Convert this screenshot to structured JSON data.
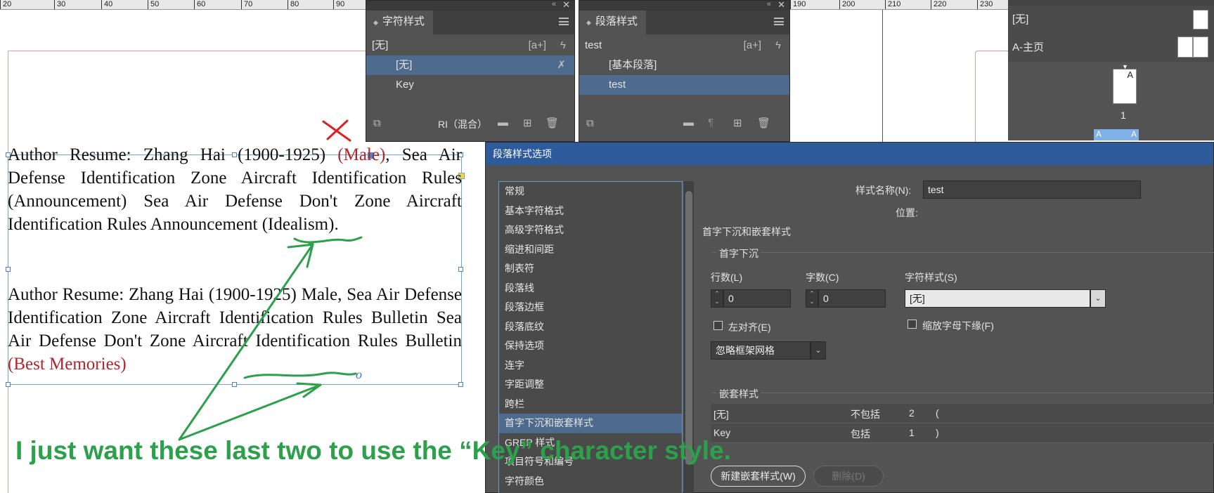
{
  "ruler": {
    "left_ticks": [
      "20",
      "30",
      "40",
      "50",
      "60",
      "70",
      "80",
      "90"
    ],
    "right_ticks": [
      "190",
      "200",
      "210",
      "220",
      "230"
    ]
  },
  "document": {
    "para1": {
      "text_a": "Author Resume: Zhang Hai (1900-1925) ",
      "text_red": "(Male)",
      "text_b": ", Sea Air Defense Identification Zone Aircraft Identification Rules (Announcement) Sea Air Defense Don't Zone Aircraft Identification Rules Announcement (Idealism)."
    },
    "para2": {
      "text_a": "Author Resume: Zhang Hai (1900-1925) Male, Sea Air Defense Identification Zone Aircraft Identification Rules Bulletin Sea Air Defense Don't Zone Aircraft Identification Rules Bulletin ",
      "text_red": "(Best Memories)"
    },
    "overset": "o"
  },
  "char_styles_panel": {
    "tab": "字符样式",
    "current": "[无]",
    "items": [
      "[无]",
      "Key"
    ],
    "footer_label": "RI（混合）"
  },
  "para_styles_panel": {
    "tab": "段落样式",
    "current": "test",
    "items": [
      "[基本段落]",
      "test"
    ]
  },
  "pages_panel": {
    "none_label": "[无]",
    "master_label": "A-主页",
    "page_letter": "A",
    "page_number": "1",
    "spread_left": "A",
    "spread_right": "A"
  },
  "dialog": {
    "title": "段落样式选项",
    "categories": [
      "常规",
      "基本字符格式",
      "高级字符格式",
      "缩进和间距",
      "制表符",
      "段落线",
      "段落边框",
      "段落底纹",
      "保持选项",
      "连字",
      "字距调整",
      "跨栏",
      "首字下沉和嵌套样式",
      "GREP 样式",
      "项目符号和编号",
      "字符颜色"
    ],
    "selected_category": "首字下沉和嵌套样式",
    "style_name_label": "样式名称(N):",
    "style_name_value": "test",
    "position_label": "位置:",
    "section_title": "首字下沉和嵌套样式",
    "drop_cap": {
      "group_label": "首字下沉",
      "lines_label": "行数(L)",
      "lines_value": "0",
      "chars_label": "字数(C)",
      "chars_value": "0",
      "char_style_label": "字符样式(S)",
      "char_style_value": "[无]",
      "align_left_label": "左对齐(E)",
      "scale_descenders_label": "缩放字母下缘(F)",
      "grid_option": "忽略框架网格"
    },
    "nested": {
      "group_label": "嵌套样式",
      "rows": [
        {
          "style": "[无]",
          "mode": "不包括",
          "count": "2",
          "char": "("
        },
        {
          "style": "Key",
          "mode": "包括",
          "count": "1",
          "char": ")"
        }
      ],
      "new_button": "新建嵌套样式(W)",
      "delete_button": "删除(D)"
    }
  },
  "annotation": {
    "note": "I just want these last two to use the “Key” character style."
  },
  "colors": {
    "panel": "#535353",
    "selection": "#4e6a8c",
    "dialog_title": "#2c5a9a",
    "annotation": "#2ca04a",
    "red_text": "#b0252b"
  }
}
